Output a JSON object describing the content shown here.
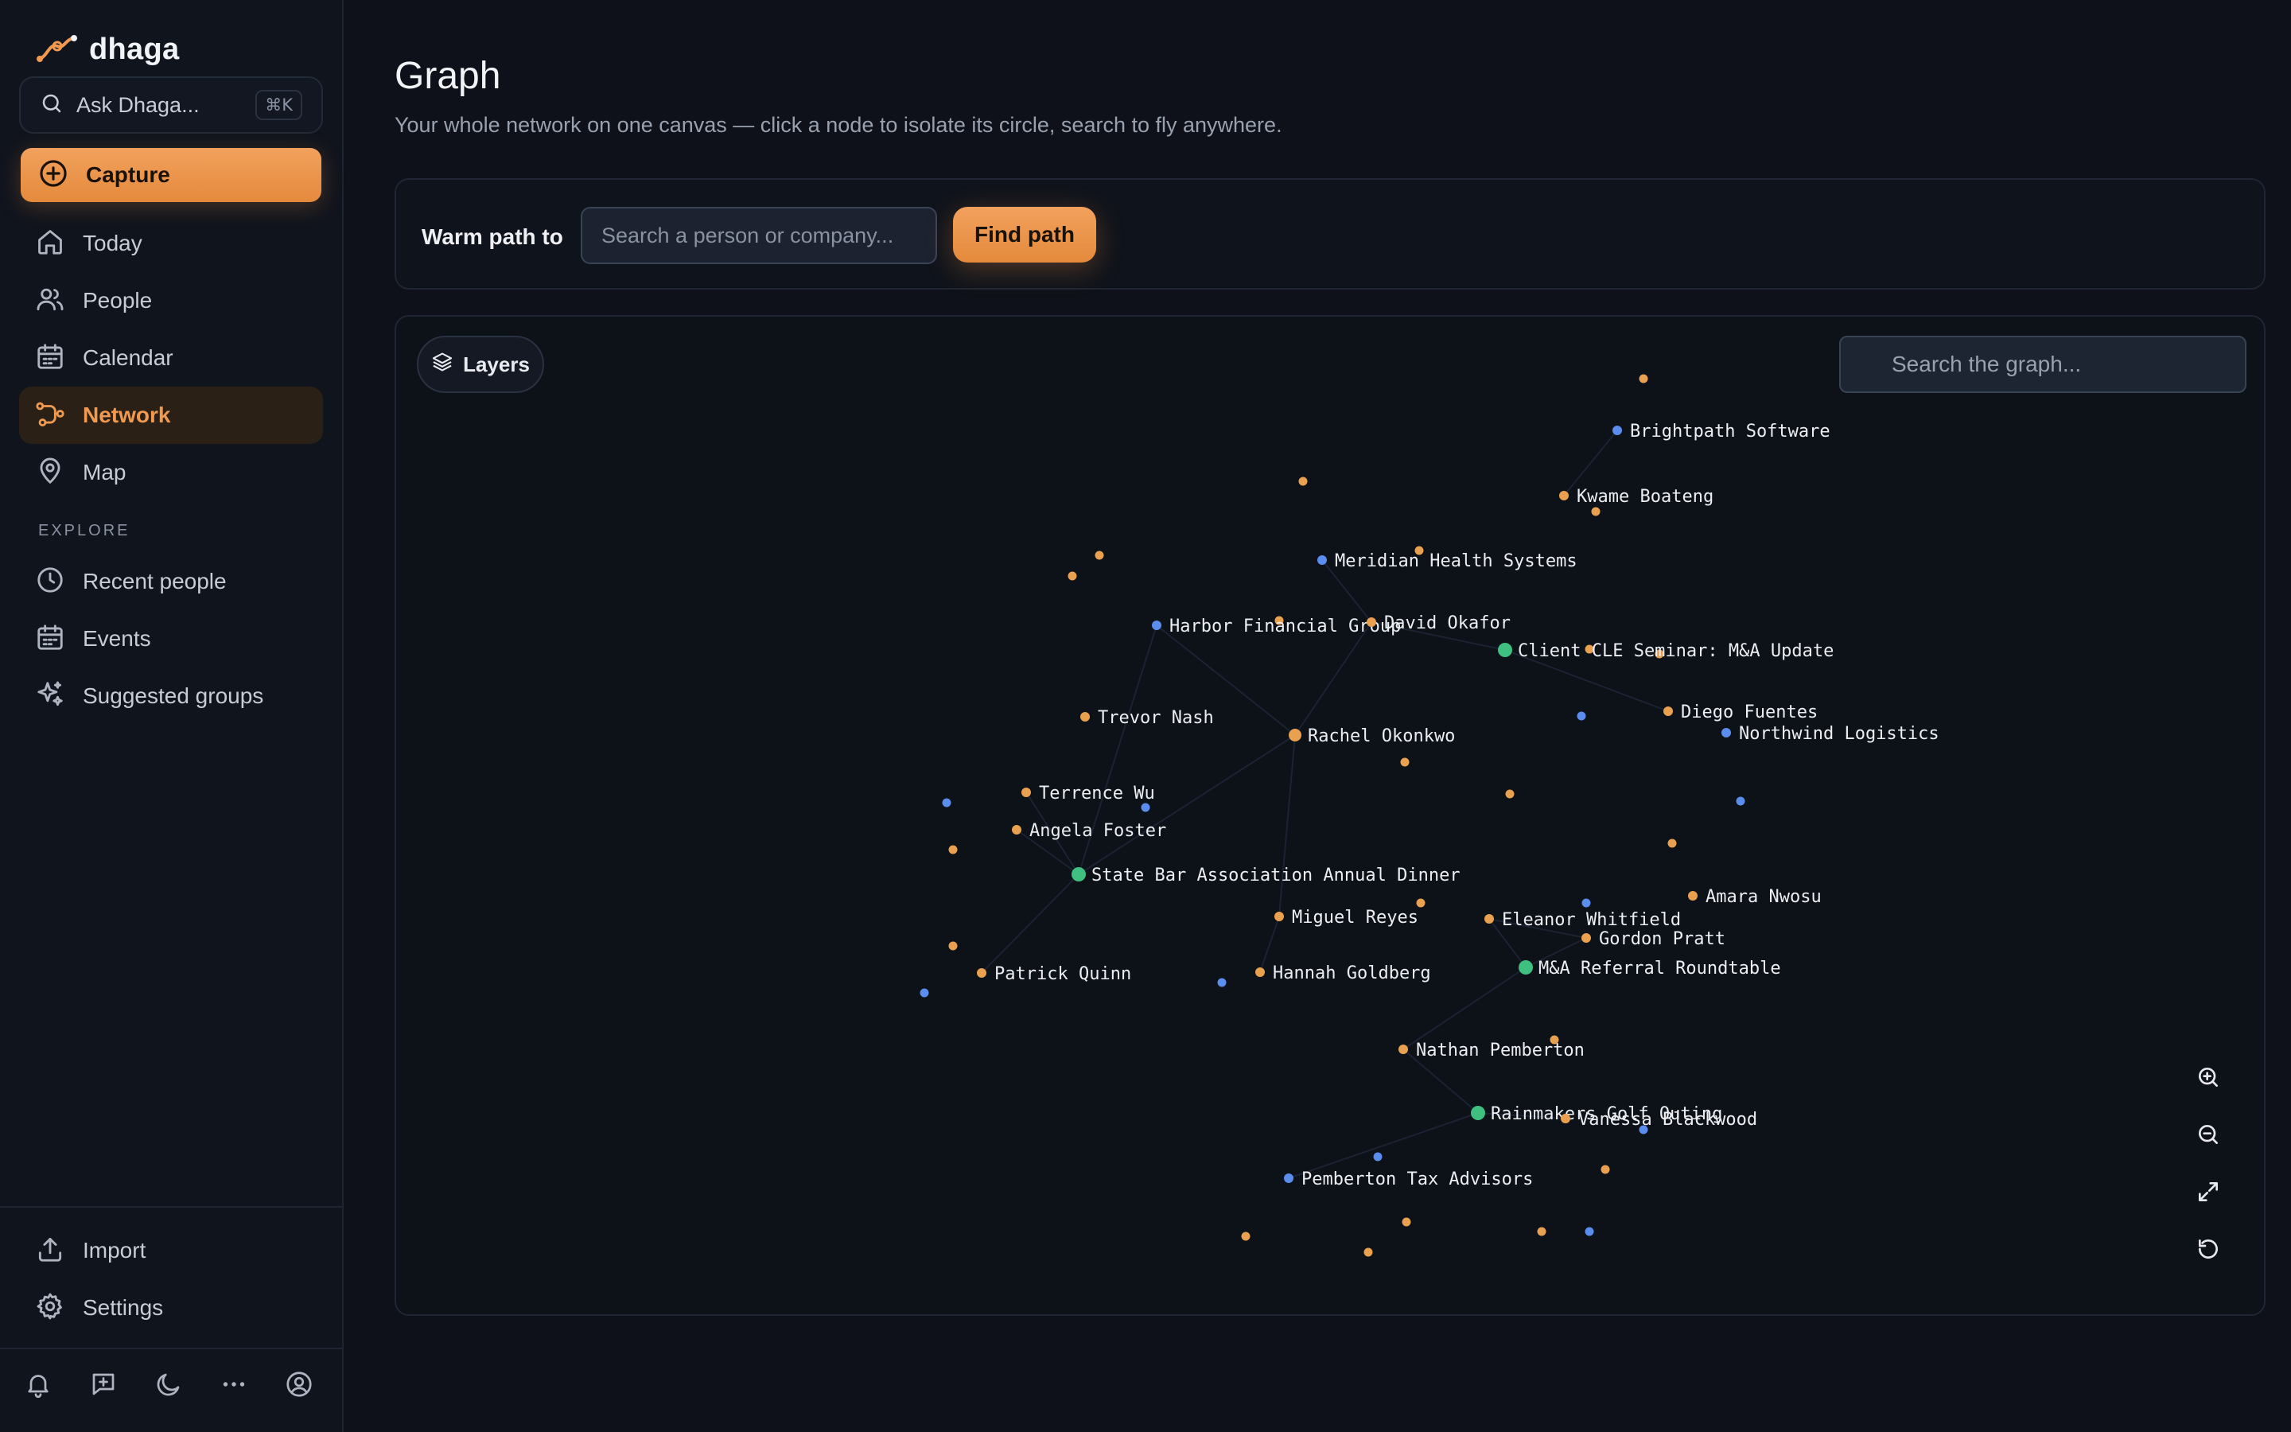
{
  "brand": {
    "name": "dhaga"
  },
  "ask": {
    "placeholder": "Ask Dhaga...",
    "shortcut": "⌘K"
  },
  "capture": {
    "label": "Capture"
  },
  "nav": [
    {
      "label": "Today",
      "icon": "home-icon"
    },
    {
      "label": "People",
      "icon": "users-icon"
    },
    {
      "label": "Calendar",
      "icon": "calendar-icon"
    },
    {
      "label": "Network",
      "icon": "network-icon",
      "active": true
    },
    {
      "label": "Map",
      "icon": "map-pin-icon"
    }
  ],
  "explore": {
    "heading": "EXPLORE",
    "items": [
      {
        "label": "Recent people",
        "icon": "clock-icon"
      },
      {
        "label": "Events",
        "icon": "calendar-icon"
      },
      {
        "label": "Suggested groups",
        "icon": "sparkles-icon"
      }
    ]
  },
  "footer_nav": [
    {
      "label": "Import",
      "icon": "upload-icon"
    },
    {
      "label": "Settings",
      "icon": "gear-icon"
    }
  ],
  "bottom_icons": [
    "bell-icon",
    "message-plus-icon",
    "moon-icon",
    "more-icon",
    "user-circle-icon"
  ],
  "page": {
    "title": "Graph",
    "subtitle": "Your whole network on one canvas — click a node to isolate its circle, search to fly anywhere."
  },
  "warm_path": {
    "label": "Warm path to",
    "placeholder": "Search a person or company...",
    "button": "Find path"
  },
  "graph": {
    "layers_label": "Layers",
    "search_placeholder": "Search the graph...",
    "colors": {
      "person": "#e9a14f",
      "company": "#5b8def",
      "event": "#3fbf80"
    },
    "zoom_controls": [
      "zoom-in-icon",
      "zoom-out-icon",
      "fit-screen-icon",
      "reset-icon"
    ],
    "nodes": [
      {
        "label": "Brightpath Software",
        "kind": "company"
      },
      {
        "label": "Kwame Boateng",
        "kind": "person"
      },
      {
        "label": "Meridian Health Systems",
        "kind": "company"
      },
      {
        "label": "Harbor Financial Group",
        "kind": "company"
      },
      {
        "label": "David Okafor",
        "kind": "person"
      },
      {
        "label": "Client CLE Seminar: M&A Update",
        "kind": "event"
      },
      {
        "label": "Trevor Nash",
        "kind": "person"
      },
      {
        "label": "Rachel Okonkwo",
        "kind": "person"
      },
      {
        "label": "Diego Fuentes",
        "kind": "person"
      },
      {
        "label": "Northwind Logistics",
        "kind": "company"
      },
      {
        "label": "Terrence Wu",
        "kind": "person"
      },
      {
        "label": "Angela Foster",
        "kind": "person"
      },
      {
        "label": "State Bar Association Annual Dinner",
        "kind": "event"
      },
      {
        "label": "Miguel Reyes",
        "kind": "person"
      },
      {
        "label": "Eleanor Whitfield",
        "kind": "person"
      },
      {
        "label": "Amara Nwosu",
        "kind": "person"
      },
      {
        "label": "Gordon Pratt",
        "kind": "person"
      },
      {
        "label": "Patrick Quinn",
        "kind": "person"
      },
      {
        "label": "Hannah Goldberg",
        "kind": "person"
      },
      {
        "label": "M&A Referral Roundtable",
        "kind": "event"
      },
      {
        "label": "Nathan Pemberton",
        "kind": "person"
      },
      {
        "label": "Rainmakers Golf Outing",
        "kind": "event"
      },
      {
        "label": "Vanessa Blackwood",
        "kind": "person"
      },
      {
        "label": "Pemberton Tax Advisors",
        "kind": "company"
      }
    ]
  }
}
